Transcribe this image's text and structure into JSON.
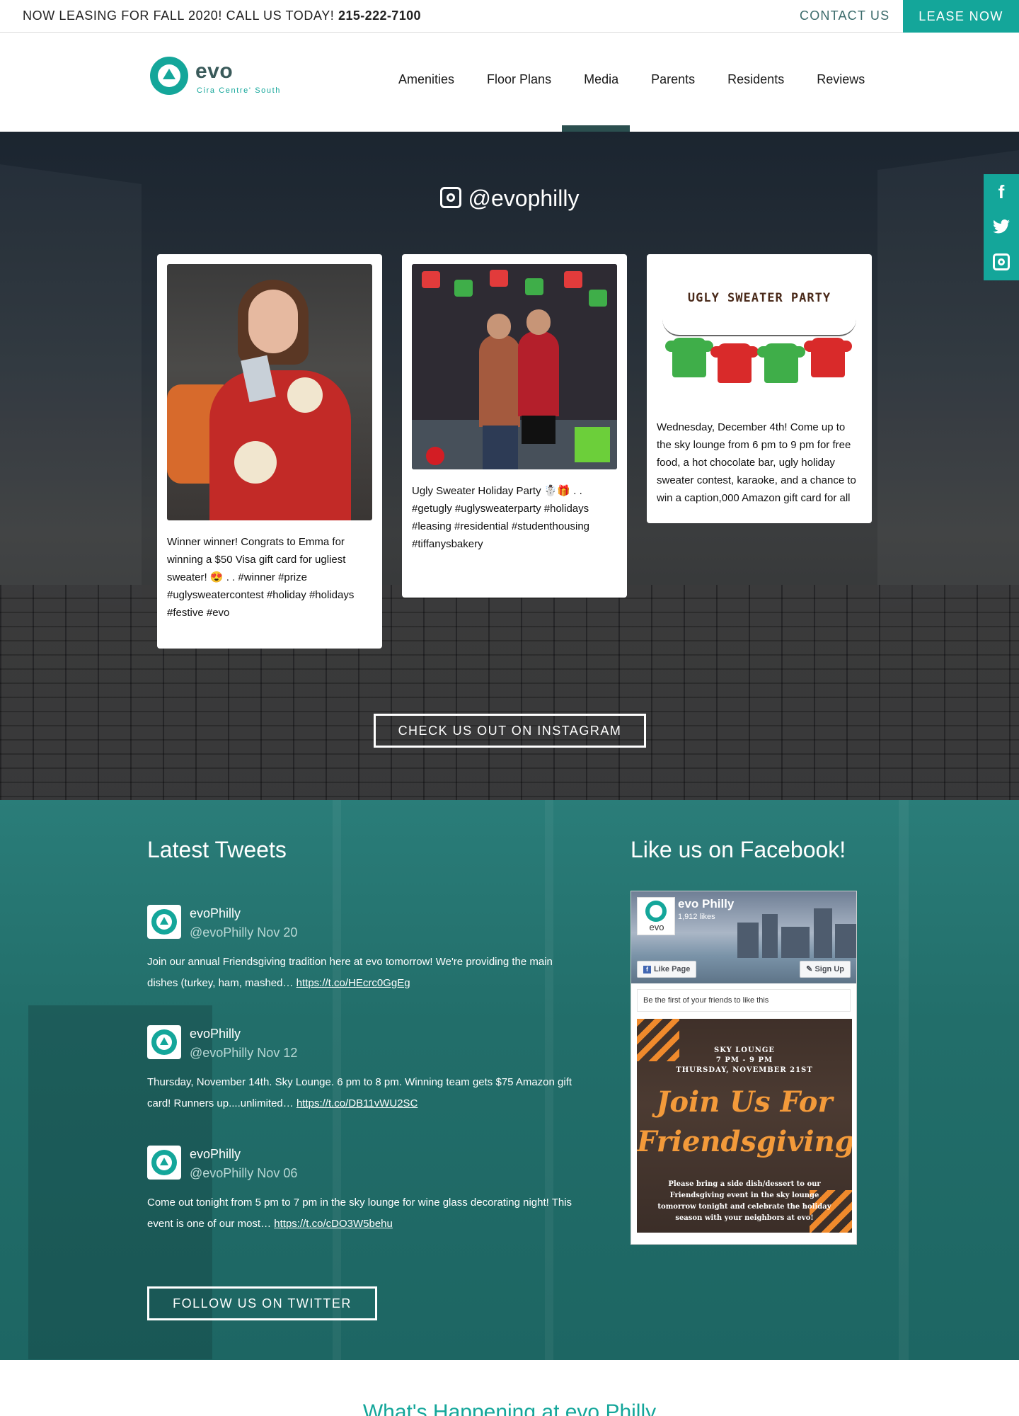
{
  "topbar": {
    "announcement": "NOW LEASING FOR FALL 2020! CALL US TODAY!",
    "phone": "215-222-7100",
    "contact_label": "CONTACT US",
    "lease_label": "LEASE NOW"
  },
  "header": {
    "logo_word": "evo",
    "logo_sub": "Cira Centre' South",
    "nav": [
      "Amenities",
      "Floor Plans",
      "Media",
      "Parents",
      "Residents",
      "Reviews"
    ],
    "active_nav": "Media"
  },
  "instagram": {
    "handle": "@evophilly",
    "posts": [
      {
        "caption": "Winner winner! Congrats to Emma for winning a $50 Visa gift card for ugliest sweater! 😍 . . #winner #prize #uglysweatercontest #holiday #holidays #festive #evo"
      },
      {
        "caption": "Ugly Sweater Holiday Party ☃️🎁 . . #getugly #uglysweaterparty #holidays #leasing #residential #studenthousing #tiffanysbakery"
      },
      {
        "image_text": "UGLY SWEATER PARTY",
        "caption": "Wednesday, December 4th! Come up to the sky lounge from 6 pm to 9 pm for free food, a hot chocolate bar, ugly holiday sweater contest, karaoke, and a chance to win a caption,000 Amazon gift card for all"
      }
    ],
    "cta_label": "CHECK US OUT ON INSTAGRAM"
  },
  "tweets": {
    "heading": "Latest Tweets",
    "items": [
      {
        "name": "evoPhilly",
        "meta": "@evoPhilly Nov 20",
        "text": "Join our annual Friendsgiving tradition here at evo tomorrow! We're providing the main dishes (turkey, ham, mashed… ",
        "link": "https://t.co/HEcrc0GgEg"
      },
      {
        "name": "evoPhilly",
        "meta": "@evoPhilly Nov 12",
        "text": "Thursday, November 14th. Sky Lounge. 6 pm to 8 pm. Winning team gets $75 Amazon gift card! Runners up....unlimited… ",
        "link": "https://t.co/DB11vWU2SC"
      },
      {
        "name": "evoPhilly",
        "meta": "@evoPhilly Nov 06",
        "text": "Come out tonight from 5 pm to 7 pm in the sky lounge for wine glass decorating night! This event is one of our most… ",
        "link": "https://t.co/cDO3W5behu"
      }
    ],
    "cta_label": "FOLLOW US ON TWITTER"
  },
  "facebook": {
    "heading": "Like us on Facebook!",
    "page_name": "evo Philly",
    "likes": "1,912 likes",
    "pic_text": "evo",
    "like_label": "Like Page",
    "signup_label": "Sign Up",
    "friends_text": "Be the first of your friends to like this",
    "post": {
      "top": "SKY LOUNGE\n7 PM - 9 PM\nTHURSDAY, NOVEMBER 21ST",
      "script": "Join Us For Friendsgiving",
      "small": "Please bring a side dish/dessert to our Friendsgiving event in the sky lounge tomorrow tonight and celebrate the holiday season with your neighbors at evo!"
    }
  },
  "social": {
    "facebook_glyph": "f"
  },
  "footer_heading": "What's Happening at evo Philly",
  "colors": {
    "accent": "#14a69a",
    "teal_section": "#226e6a",
    "dark_nav": "#2b4f4f"
  }
}
